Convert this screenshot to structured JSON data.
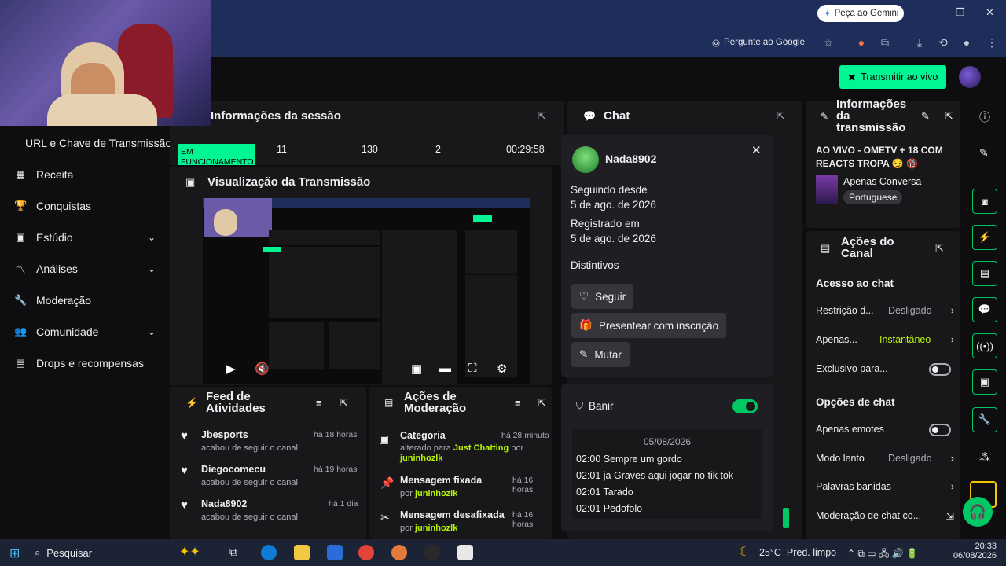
{
  "browser": {
    "gemini_label": "Peça ao Gemini",
    "ask_google": "Pergunte ao Google"
  },
  "header": {
    "go_live": "Transmitir ao vivo"
  },
  "nav": {
    "stream_key": "URL e Chave de Transmissão",
    "items": [
      {
        "label": "Receita"
      },
      {
        "label": "Conquistas"
      },
      {
        "label": "Estúdio"
      },
      {
        "label": "Análises"
      },
      {
        "label": "Moderação"
      },
      {
        "label": "Comunidade"
      },
      {
        "label": "Drops e recompensas"
      }
    ]
  },
  "session": {
    "title": "Informações da sessão",
    "status": "EM FUNCIONAMENTO",
    "stats": [
      "11",
      "130",
      "2",
      "00:29:58"
    ]
  },
  "preview": {
    "title": "Visualização da Transmissão"
  },
  "activity": {
    "title": "Feed de Atividades",
    "items": [
      {
        "name": "Jbesports",
        "action": "acabou de seguir o canal",
        "time": "há 18 horas"
      },
      {
        "name": "Diegocomecu",
        "action": "acabou de seguir o canal",
        "time": "há 19 horas"
      },
      {
        "name": "Nada8902",
        "action": "acabou de seguir o canal",
        "time": "há 1 dia"
      }
    ]
  },
  "modactions": {
    "title": "Ações de Moderação",
    "items": [
      {
        "title": "Categoria",
        "time": "há 28 minuto",
        "line1_prefix": "alterado para ",
        "line1_value": "Just Chatting",
        "line1_suffix": " por",
        "by": "juninhozlk"
      },
      {
        "title": "Mensagem fixada",
        "time": "há 16 horas",
        "line1_prefix": "por ",
        "by": "juninhozlk"
      },
      {
        "title": "Mensagem desafixada",
        "time": "há 16 horas",
        "line1_prefix": "por ",
        "by": "juninhozlk"
      }
    ]
  },
  "chat": {
    "title": "Chat",
    "user": {
      "name": "Nada8902",
      "following_label": "Seguindo desde",
      "following_date": "5 de ago. de 2026",
      "registered_label": "Registrado em",
      "registered_date": "5 de ago. de 2026",
      "badges_label": "Distintivos",
      "follow_btn": "Seguir",
      "gift_btn": "Presentear com inscrição",
      "mute_btn": "Mutar",
      "ban_label": "Banir",
      "log_date": "05/08/2026",
      "messages": [
        {
          "time": "02:00",
          "text": "Sempre um gordo"
        },
        {
          "time": "02:01",
          "text": "ja Graves aqui jogar no tik tok"
        },
        {
          "time": "02:01",
          "text": "Tarado"
        },
        {
          "time": "02:01",
          "text": "Pedofolo"
        }
      ]
    }
  },
  "stream_info": {
    "title": "Informações da transmissão",
    "stream_title": "AO VIVO - OMETV + 18 COM REACTS TROPA 😏 🔞",
    "category": "Apenas Conversa",
    "language": "Portuguese"
  },
  "channel_actions": {
    "title": "Ações do Canal",
    "chat_access": "Acesso ao chat",
    "rows": [
      {
        "label": "Restrição d...",
        "value": "Desligado"
      },
      {
        "label": "Apenas...",
        "value": "Instantâneo"
      },
      {
        "label": "Exclusivo para..."
      }
    ],
    "chat_options": "Opções de chat",
    "rows2": [
      {
        "label": "Apenas emotes"
      },
      {
        "label": "Modo lento",
        "value": "Desligado"
      },
      {
        "label": "Palavras banidas"
      },
      {
        "label": "Moderação de chat co..."
      }
    ]
  },
  "taskbar": {
    "search": "Pesquisar",
    "weather": "25°C  Pred. limpo",
    "time": "20:33",
    "date": "06/08/2026"
  },
  "colors": {
    "accent": "#00f593",
    "panel": "#18181b",
    "bg": "#0e0e10",
    "highlight": "#b9f500"
  }
}
